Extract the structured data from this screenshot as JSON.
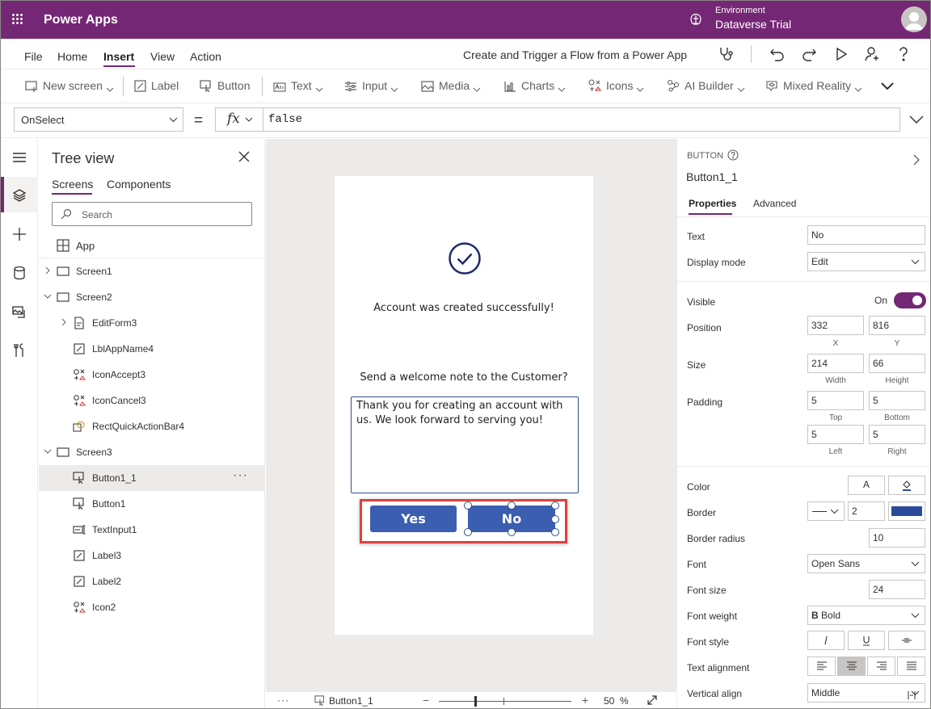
{
  "app": {
    "brand": "Power Apps",
    "environment_label": "Environment",
    "environment_name": "Dataverse Trial"
  },
  "menu": {
    "items": [
      "File",
      "Home",
      "Insert",
      "View",
      "Action"
    ],
    "active": "Insert",
    "flow_link": "Create and Trigger a Flow from a Power App"
  },
  "ribbon": {
    "new_screen": "New screen",
    "label": "Label",
    "button": "Button",
    "text": "Text",
    "input": "Input",
    "media": "Media",
    "charts": "Charts",
    "icons": "Icons",
    "ai_builder": "AI Builder",
    "mixed_reality": "Mixed Reality"
  },
  "formula_bar": {
    "property": "OnSelect",
    "equals": "=",
    "fx": "fx",
    "formula": "false"
  },
  "tree": {
    "title": "Tree view",
    "tabs": [
      "Screens",
      "Components"
    ],
    "search_placeholder": "Search",
    "app_label": "App",
    "nodes": [
      {
        "label": "Screen1",
        "icon": "screen-icon"
      },
      {
        "label": "Screen2",
        "icon": "screen-icon"
      },
      {
        "label": "EditForm3",
        "icon": "form-icon"
      },
      {
        "label": "LblAppName4",
        "icon": "label-icon"
      },
      {
        "label": "IconAccept3",
        "icon": "icons-icon"
      },
      {
        "label": "IconCancel3",
        "icon": "icons-icon"
      },
      {
        "label": "RectQuickActionBar4",
        "icon": "shapes-icon"
      },
      {
        "label": "Screen3",
        "icon": "screen-icon"
      },
      {
        "label": "Button1_1",
        "icon": "button-icon",
        "selected": true
      },
      {
        "label": "Button1",
        "icon": "button-icon"
      },
      {
        "label": "TextInput1",
        "icon": "text-input-icon"
      },
      {
        "label": "Label3",
        "icon": "label-icon"
      },
      {
        "label": "Label2",
        "icon": "label-icon"
      },
      {
        "label": "Icon2",
        "icon": "icons-icon"
      }
    ],
    "more": "···"
  },
  "screen": {
    "success_text": "Account was created successfully!",
    "question": "Send a welcome note to the Customer?",
    "note": "Thank you for creating an account with us. We look forward to serving you!",
    "yes_label": "Yes",
    "no_label": "No"
  },
  "statusbar": {
    "dots": "···",
    "crumb": "Button1_1",
    "minus": "−",
    "plus": "+",
    "zoom": "50",
    "zoom_unit": "%"
  },
  "properties": {
    "type": "BUTTON",
    "name": "Button1_1",
    "tabs": {
      "properties": "Properties",
      "advanced": "Advanced"
    },
    "text_label": "Text",
    "text_value": "No",
    "display_mode_label": "Display mode",
    "display_mode_value": "Edit",
    "visible_label": "Visible",
    "visible_value": "On",
    "position_label": "Position",
    "x": "332",
    "y": "816",
    "x_label": "X",
    "y_label": "Y",
    "size_label": "Size",
    "width": "214",
    "height": "66",
    "width_label": "Width",
    "height_label": "Height",
    "padding_label": "Padding",
    "pad_top": "5",
    "pad_bottom": "5",
    "pad_left": "5",
    "pad_right": "5",
    "top_label": "Top",
    "bottom_label": "Bottom",
    "left_label": "Left",
    "right_label": "Right",
    "color_label": "Color",
    "color_text_glyph": "A",
    "border_label": "Border",
    "border_width": "2",
    "border_color": "#2b4a9c",
    "border_radius_label": "Border radius",
    "border_radius": "10",
    "font_label": "Font",
    "font_value": "Open Sans",
    "font_size_label": "Font size",
    "font_size": "24",
    "font_weight_label": "Font weight",
    "font_weight": "Bold",
    "font_weight_glyph": "B",
    "font_style_label": "Font style",
    "text_alignment_label": "Text alignment",
    "vertical_align_label": "Vertical align",
    "vertical_align": "Middle"
  },
  "colors": {
    "brand": "#742774",
    "button": "#3b5eb1",
    "highlight": "#e04040"
  }
}
